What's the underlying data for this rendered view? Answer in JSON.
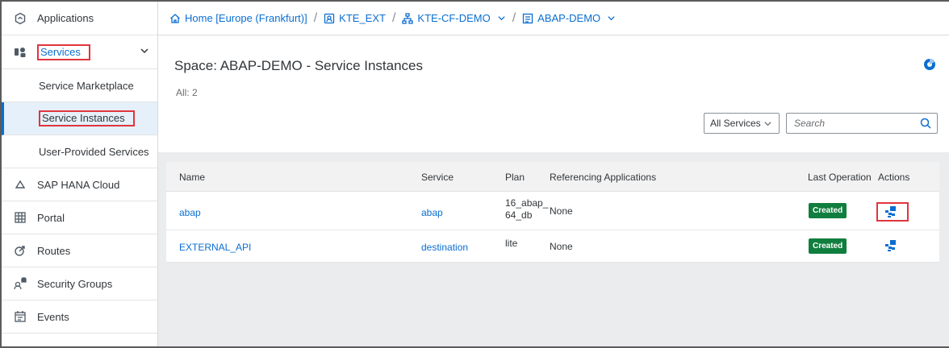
{
  "sidebar": {
    "items": [
      {
        "label": "Applications",
        "icon": "applications-icon"
      },
      {
        "label": "Services",
        "icon": "services-icon",
        "expanded": true,
        "highlighted": true
      },
      {
        "label": "Service Marketplace"
      },
      {
        "label": "Service Instances",
        "active": true,
        "highlighted": true
      },
      {
        "label": "User-Provided Services"
      },
      {
        "label": "SAP HANA Cloud",
        "icon": "cloud-icon"
      },
      {
        "label": "Portal",
        "icon": "portal-icon"
      },
      {
        "label": "Routes",
        "icon": "routes-icon"
      },
      {
        "label": "Security Groups",
        "icon": "security-groups-icon"
      },
      {
        "label": "Events",
        "icon": "events-icon"
      }
    ]
  },
  "breadcrumb": {
    "home": "Home [Europe (Frankfurt)]",
    "subaccount": "KTE_EXT",
    "org": "KTE-CF-DEMO",
    "space": "ABAP-DEMO",
    "separator": "/"
  },
  "header": {
    "title": "Space: ABAP-DEMO - Service Instances",
    "count": "All: 2"
  },
  "filter": {
    "selected": "All Services"
  },
  "search": {
    "placeholder": "Search"
  },
  "table": {
    "columns": {
      "name": "Name",
      "service": "Service",
      "plan": "Plan",
      "ref_apps": "Referencing Applications",
      "last_op": "Last Operation",
      "actions": "Actions"
    },
    "rows": [
      {
        "name": "abap",
        "service": "abap",
        "plan_line1": "16_abap_",
        "plan_line2": "64_db",
        "ref_apps": "None",
        "last_op": "Created",
        "action_icon": "service-keys-icon"
      },
      {
        "name": "EXTERNAL_API",
        "service": "destination",
        "plan_line1": "lite",
        "plan_line2": "",
        "ref_apps": "None",
        "last_op": "Created",
        "action_icon": "service-keys-icon"
      }
    ]
  },
  "colors": {
    "accent": "#0a6ed1",
    "status_created": "#107e3e",
    "highlight_box": "#e0353d",
    "active_nav_bg": "#e5f0fa"
  }
}
